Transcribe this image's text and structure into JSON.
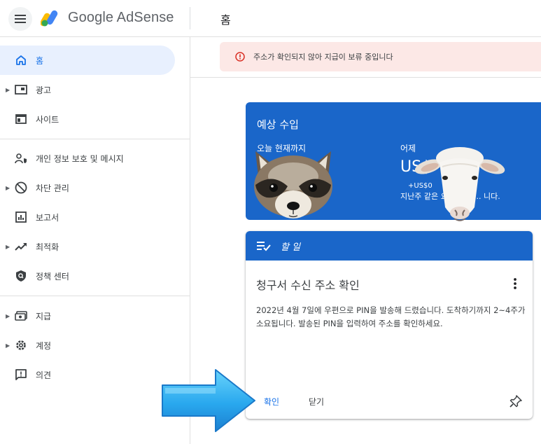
{
  "header": {
    "brand": "Google AdSense",
    "page_title": "홈"
  },
  "sidebar": {
    "items": [
      {
        "label": "홈",
        "icon": "home-icon",
        "active": true
      },
      {
        "label": "광고",
        "icon": "ads-icon",
        "expandable": true
      },
      {
        "label": "사이트",
        "icon": "sites-icon"
      },
      {
        "label": "개인 정보 보호 및 메시지",
        "icon": "privacy-messaging-icon"
      },
      {
        "label": "차단 관리",
        "icon": "block-icon",
        "expandable": true
      },
      {
        "label": "보고서",
        "icon": "reports-icon"
      },
      {
        "label": "최적화",
        "icon": "trending-up-icon",
        "expandable": true
      },
      {
        "label": "정책 센터",
        "icon": "policy-shield-icon"
      },
      {
        "label": "지급",
        "icon": "payments-icon",
        "expandable": true
      },
      {
        "label": "계정",
        "icon": "settings-gear-icon",
        "expandable": true
      },
      {
        "label": "의견",
        "icon": "feedback-icon"
      }
    ]
  },
  "alert": {
    "text": "주소가 확인되지 않아 지급이 보류 중입니다",
    "icon": "error-icon",
    "color": "#fce8e6"
  },
  "earnings": {
    "title": "예상 수입",
    "today_label": "오늘 현재까지",
    "yesterday_label": "어제",
    "yesterday_value": "US$",
    "yesterday_change": "+US$0",
    "yesterday_compare": "지난주 같은 요일 대비 ... 니다."
  },
  "todo": {
    "header_label": "할 일",
    "title": "청구서 수신 주소 확인",
    "body": "2022년 4월 7일에 우편으로 PIN을 발송해 드렸습니다. 도착하기까지 2~4주가 소요됩니다. 발송된 PIN을 입력하여 주소를 확인하세요.",
    "confirm_label": "확인",
    "close_label": "닫기"
  },
  "colors": {
    "brand_blue": "#1a66c9",
    "accent": "#1a73e8",
    "active_bg": "#e8f0fe",
    "alert_bg": "#fce8e6"
  }
}
